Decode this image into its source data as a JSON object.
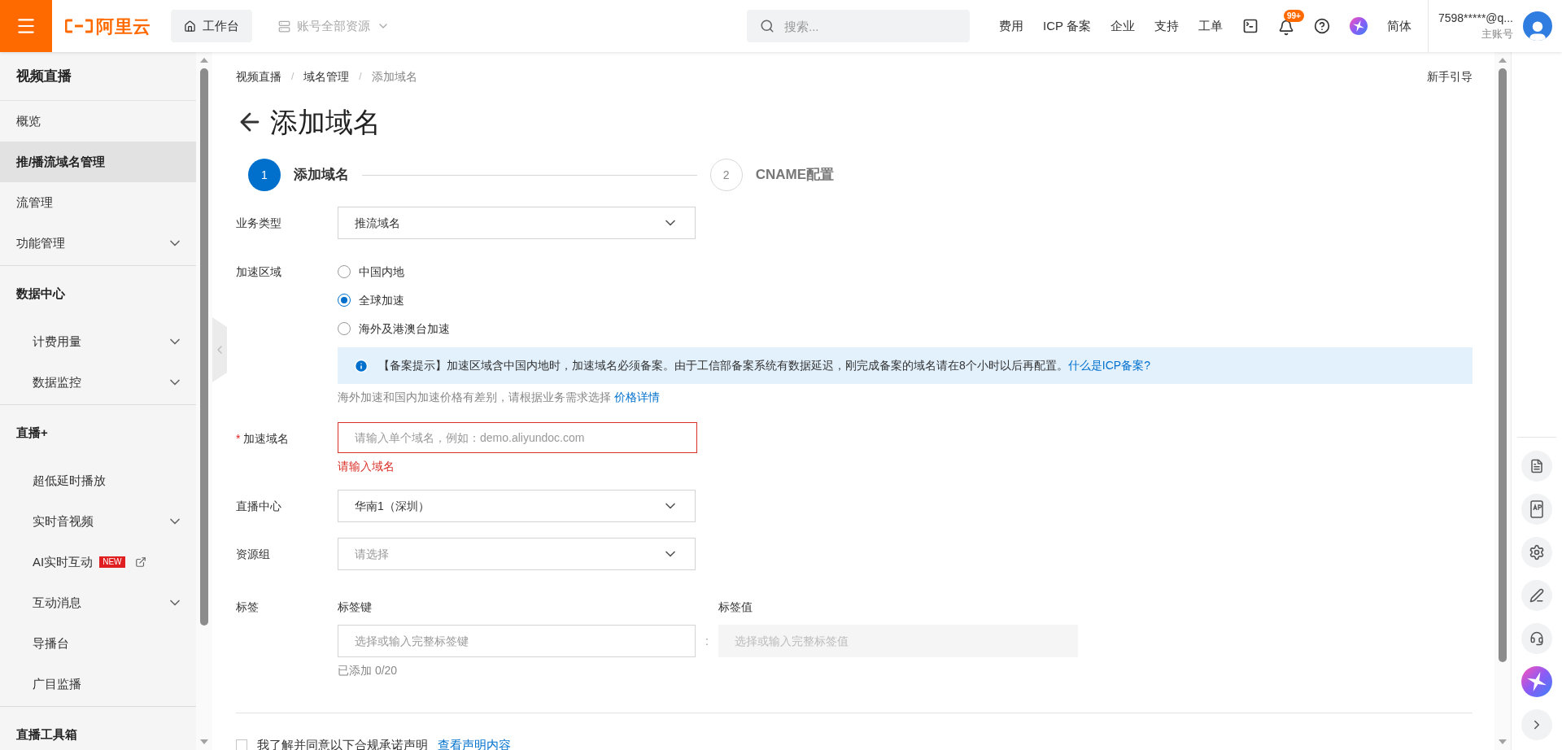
{
  "topbar": {
    "logo": "阿里云",
    "workbench": "工作台",
    "resources": {
      "label": "账号全部资源",
      "disabled": true
    },
    "search": {
      "placeholder": "搜索..."
    },
    "nav": [
      "费用",
      "ICP 备案",
      "企业",
      "支持",
      "工单"
    ],
    "notifications": {
      "badge": "99+"
    },
    "language": "简体",
    "account": {
      "name": "7598*****@q...",
      "role": "主账号"
    }
  },
  "sidebar": {
    "title": "视频直播",
    "groups": [
      {
        "items": [
          {
            "label": "概览",
            "selected": false
          },
          {
            "label": "推/播流域名管理",
            "selected": true
          },
          {
            "label": "流管理",
            "selected": false
          },
          {
            "label": "功能管理",
            "selected": false,
            "expanded": false
          }
        ]
      },
      {
        "heading": "数据中心",
        "items": [
          {
            "label": "计费用量",
            "selected": false,
            "expanded": false
          },
          {
            "label": "数据监控",
            "selected": false,
            "expanded": false
          }
        ]
      },
      {
        "heading": "直播+",
        "items": [
          {
            "label": "超低延时播放",
            "selected": false
          },
          {
            "label": "实时音视频",
            "selected": false,
            "expanded": false
          },
          {
            "label": "AI实时互动",
            "selected": false,
            "badge": "NEW",
            "external": true
          },
          {
            "label": "互动消息",
            "selected": false,
            "expanded": false
          },
          {
            "label": "导播台",
            "selected": false
          },
          {
            "label": "广目监播",
            "selected": false
          }
        ]
      },
      {
        "heading": "直播工具箱"
      }
    ]
  },
  "breadcrumb": [
    "视频直播",
    "域名管理",
    "添加域名"
  ],
  "breadcrumb_separator": "/",
  "guide_link": "新手引导",
  "page_title": "添加域名",
  "steps": [
    {
      "number": "1",
      "label": "添加域名",
      "selected": true
    },
    {
      "number": "2",
      "label": "CNAME配置",
      "selected": false
    }
  ],
  "form": {
    "fields": [
      {
        "kind": "select",
        "label": "业务类型",
        "value": "推流域名"
      },
      {
        "kind": "radio",
        "label": "加速区域",
        "options": [
          {
            "label": "中国内地",
            "selected": false
          },
          {
            "label": "全球加速",
            "selected": true
          },
          {
            "label": "海外及港澳台加速",
            "selected": false
          }
        ],
        "notice": {
          "text": "【备案提示】加速区域含中国内地时，加速域名必须备案。由于工信部备案系统有数据延迟，刚完成备案的域名请在8个小时以后再配置。",
          "link": "什么是ICP备案?"
        },
        "hint": {
          "text": "海外加速和国内加速价格有差别，请根据业务需求选择",
          "link": "价格详情"
        }
      },
      {
        "kind": "input",
        "label": "加速域名",
        "required_mark": "*",
        "placeholder": "请输入单个域名，例如：demo.aliyundoc.com",
        "error": "请输入域名"
      },
      {
        "kind": "select",
        "label": "直播中心",
        "value": "华南1（深圳）"
      },
      {
        "kind": "select",
        "label": "资源组",
        "placeholder": "请选择"
      },
      {
        "kind": "tags",
        "label": "标签",
        "key": {
          "header": "标签键",
          "placeholder": "选择或输入完整标签键",
          "disabled": false
        },
        "value": {
          "header": "标签值",
          "placeholder": "选择或输入完整标签值",
          "disabled": true
        },
        "separator": ":",
        "count": "已添加 0/20"
      }
    ]
  },
  "agreement": {
    "checked": false,
    "text": "我了解并同意以下合规承诺声明",
    "link": "查看声明内容"
  }
}
